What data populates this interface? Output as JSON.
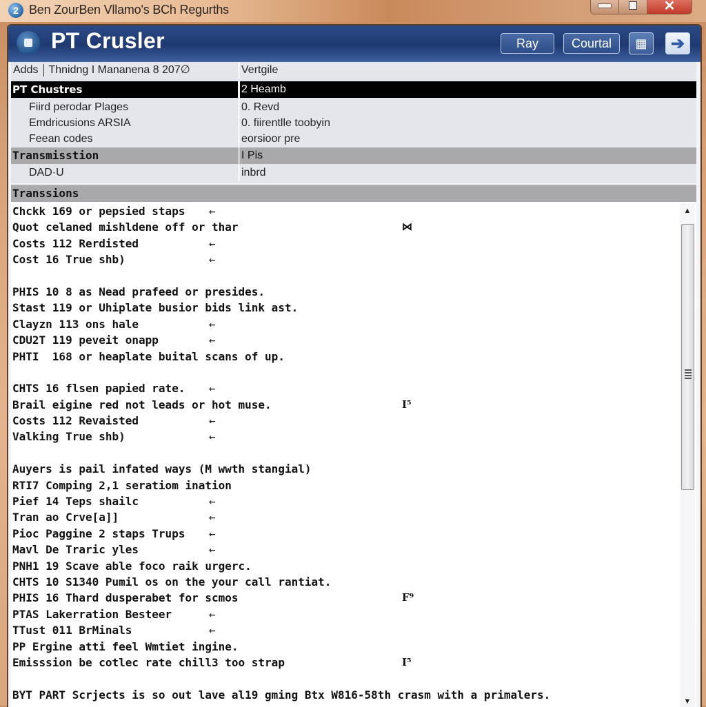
{
  "os_window": {
    "title": "Ben ZourBen Vllamo's BCh Regurths",
    "app_icon_glyph": "2",
    "controls": {
      "minimize": "minimize",
      "maximize": "maximize",
      "close": "✕"
    }
  },
  "app": {
    "title": "PT Crusler",
    "buttons": {
      "primary": "Ray",
      "secondary": "Courtal"
    },
    "icons": {
      "logo": "app-logo-icon",
      "grid": "grid-icon",
      "forward": "forward-arrow-icon"
    },
    "icon_glyphs": {
      "grid": "▦",
      "forward": "➔"
    }
  },
  "properties": {
    "header": {
      "col1_part1": "Adds",
      "col1_part2": "Thnidng I Mananena 8 207∅",
      "col2": "Vertgile"
    },
    "rows": [
      {
        "type": "selected",
        "name": "PT Chustres",
        "value": "2 Heamb"
      },
      {
        "type": "sub",
        "name": "Fiird perodar Plages",
        "value": "0. Revd"
      },
      {
        "type": "sub",
        "name": "Emdricusions ARSIA",
        "value": "0. fiirentlle toobyin"
      },
      {
        "type": "sub",
        "name": "Feean codes",
        "value": "eorsioor pre"
      },
      {
        "type": "group",
        "name": "Transmisstion",
        "value": "I Pis"
      },
      {
        "type": "sub",
        "name": "DAD·U",
        "value": "inbrd"
      }
    ]
  },
  "log": {
    "title": "Transsions",
    "lines": [
      {
        "text": "Chckk 169 or pepsied staps",
        "arrow": "←",
        "mark": ""
      },
      {
        "text": "Quot celaned mishldene off or thar",
        "arrow": "",
        "mark": "⋈"
      },
      {
        "text": "Costs 112 Rerdisted",
        "arrow": "←",
        "mark": ""
      },
      {
        "text": "Cost 16 True shb)",
        "arrow": "←",
        "mark": ""
      },
      {
        "text": "",
        "arrow": "",
        "mark": ""
      },
      {
        "text": "PHIS 10 8 as Nead prafeed or presides.",
        "arrow": "",
        "mark": ""
      },
      {
        "text": "Stast 119 or Uhiplate busior bids link ast.",
        "arrow": "",
        "mark": ""
      },
      {
        "text": "Clayzn 113 ons hale",
        "arrow": "←",
        "mark": ""
      },
      {
        "text": "CDU2T 119 peveit onapp",
        "arrow": "←",
        "mark": ""
      },
      {
        "text": "PHTI  168 or heaplate buital scans of up.",
        "arrow": "",
        "mark": ""
      },
      {
        "text": "",
        "arrow": "",
        "mark": ""
      },
      {
        "text": "CHTS 16 flsen papied rate.",
        "arrow": "←",
        "mark": ""
      },
      {
        "text": "Brail eigine red not leads or hot muse.",
        "arrow": "",
        "mark": "I⁵"
      },
      {
        "text": "Costs 112 Revaisted",
        "arrow": "←",
        "mark": ""
      },
      {
        "text": "Valking True shb)",
        "arrow": "←",
        "mark": ""
      },
      {
        "text": "",
        "arrow": "",
        "mark": ""
      },
      {
        "text": "Auyers is pail infated ways (M wwth stangial)",
        "arrow": "",
        "mark": ""
      },
      {
        "text": "RTI7 Comping 2,1 seratiom ination",
        "arrow": "",
        "mark": ""
      },
      {
        "text": "Pief 14 Teps shailc",
        "arrow": "←",
        "mark": ""
      },
      {
        "text": "Tran ao Crve[a]]",
        "arrow": "←",
        "mark": ""
      },
      {
        "text": "Pioc Paggine 2 staps Trups",
        "arrow": "←",
        "mark": ""
      },
      {
        "text": "Mavl De Traric yles",
        "arrow": "←",
        "mark": ""
      },
      {
        "text": "PNH1 19 Scave able foco raik urgerc.",
        "arrow": "",
        "mark": ""
      },
      {
        "text": "CHTS 10 S1340 Pumil os on the your call rantiat.",
        "arrow": "",
        "mark": ""
      },
      {
        "text": "PHIS 16 Thard dusperabet for scmos",
        "arrow": "",
        "mark": "F⁹"
      },
      {
        "text": "PTAS Lakerration Besteer",
        "arrow": "←",
        "mark": ""
      },
      {
        "text": "TTust 011 BrMinals",
        "arrow": "←",
        "mark": ""
      },
      {
        "text": "PP Ergine atti feel Wmtiet ingine.",
        "arrow": "",
        "mark": ""
      },
      {
        "text": "Emisssion be cotlec rate chill3 too strap",
        "arrow": "",
        "mark": "I⁵"
      },
      {
        "text": "",
        "arrow": "",
        "mark": ""
      },
      {
        "text": "BYT PART Scrjects is so out lave al19 gming Btx W816-58th crasm with a primalers.",
        "arrow": "",
        "mark": ""
      }
    ],
    "scrollbar": {
      "up": "▲",
      "down": "▼"
    }
  }
}
